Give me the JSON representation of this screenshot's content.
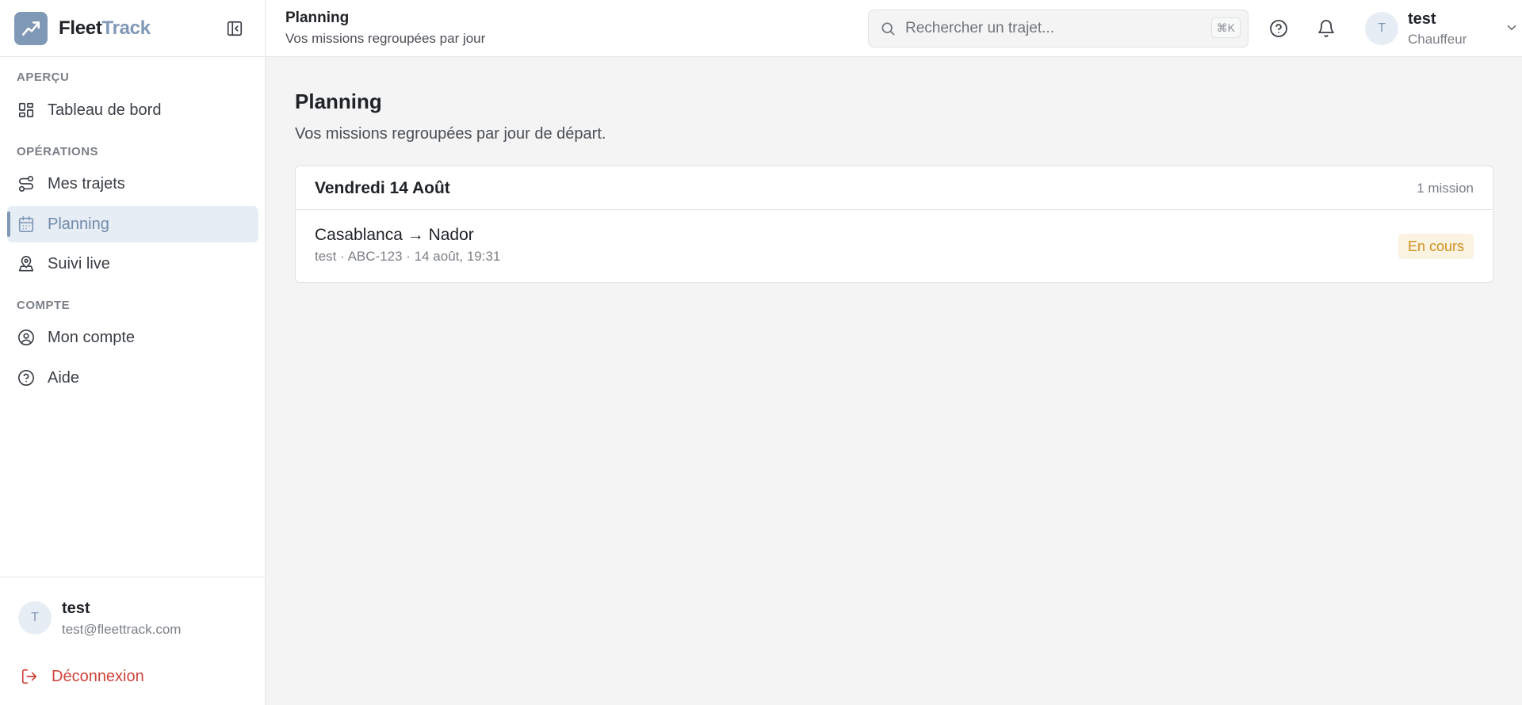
{
  "brand": {
    "name_part1": "Fleet",
    "name_part2": "Track"
  },
  "sidebar": {
    "sections": {
      "apercu": "APERÇU",
      "operations": "OPÉRATIONS",
      "compte": "COMPTE"
    },
    "items": {
      "tableau": "Tableau de bord",
      "trajets": "Mes trajets",
      "planning": "Planning",
      "suivi": "Suivi live",
      "compte": "Mon compte",
      "aide": "Aide"
    },
    "active_item": "Planning",
    "footer": {
      "avatar_initial": "T",
      "name": "test",
      "email": "test@fleettrack.com",
      "logout": "Déconnexion"
    }
  },
  "header": {
    "title": "Planning",
    "subtitle": "Vos missions regroupées par jour",
    "search": {
      "placeholder": "Rechercher un trajet...",
      "shortcut": "⌘K"
    },
    "user": {
      "initial": "T",
      "name": "test",
      "role": "Chauffeur"
    }
  },
  "main": {
    "title": "Planning",
    "subtitle": "Vos missions regroupées par jour de départ.",
    "groups": [
      {
        "day": "Vendredi 14 Août",
        "count": "1 mission",
        "missions": [
          {
            "route": "Casablanca → Nador",
            "meta": "test · ABC-123 · 14 août, 19:31",
            "status": "En cours"
          }
        ]
      }
    ]
  },
  "colors": {
    "accent": "#7f98b6",
    "active_bg": "#e7edf4",
    "status_bg": "#fbf3e1",
    "status_text": "#cf8f1c",
    "logout": "#d0433a"
  },
  "icons": {
    "logo": "trending-up-icon",
    "collapse": "sidebar-collapse-icon",
    "tableau": "layout-grid-icon",
    "trajets": "route-icon",
    "planning": "calendar-icon",
    "suivi": "map-pin-user-icon",
    "compte": "user-circle-icon",
    "aide": "help-circle-icon",
    "logout": "log-out-icon",
    "search": "search-icon",
    "help": "help-circle-icon",
    "bell": "bell-icon",
    "chevron": "chevron-down-icon"
  }
}
